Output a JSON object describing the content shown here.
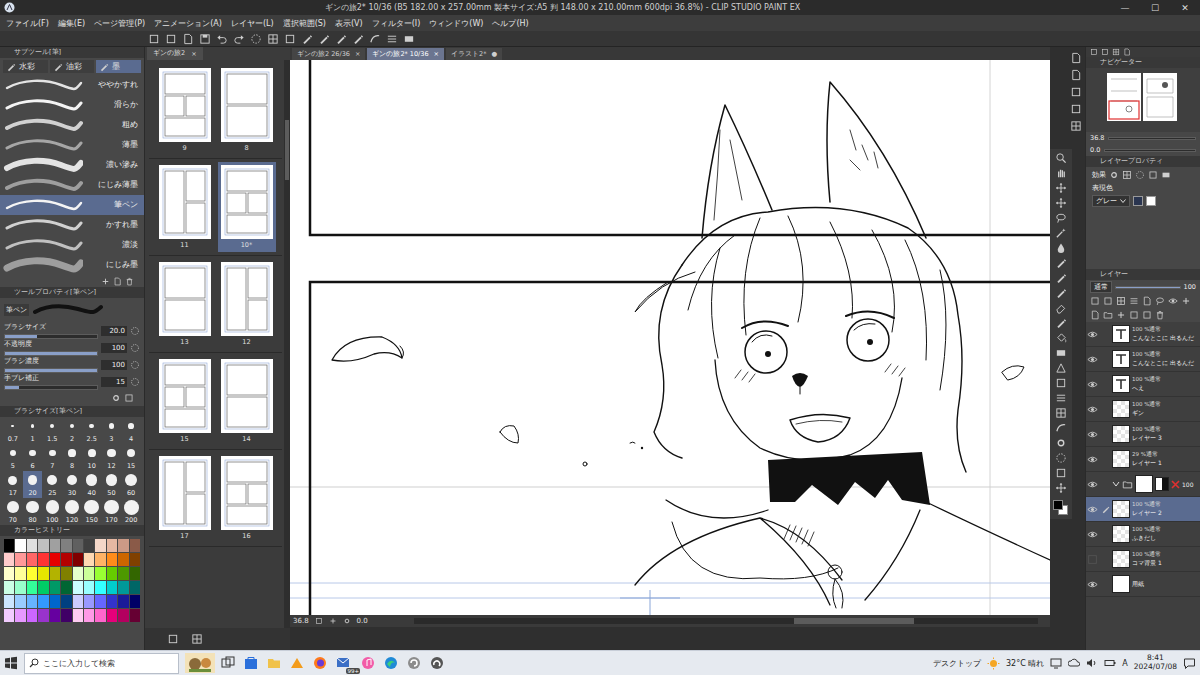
{
  "window": {
    "title": "ギンの旅2* 10/36 (B5 182.00 x 257.00mm 製本サイズ:A5 判 148.00 x 210.00mm 600dpi 36.8%) - CLIP STUDIO PAINT EX",
    "controls": [
      "—",
      "☐",
      "✕"
    ]
  },
  "menu": [
    "ファイル(F)",
    "編集(E)",
    "ページ管理(P)",
    "アニメーション(A)",
    "レイヤー(L)",
    "選択範囲(S)",
    "表示(V)",
    "フィルター(I)",
    "ウィンドウ(W)",
    "ヘルプ(H)"
  ],
  "doc_tab": {
    "label": "ギンの旅2",
    "close": "×"
  },
  "canvas_tabs": [
    {
      "label": "ギンの旅2 26/36",
      "close": "×",
      "selected": false
    },
    {
      "label": "ギンの旅2* 10/36",
      "close": "×",
      "selected": true
    },
    {
      "label": "イラスト2*",
      "close": "●",
      "selected": false
    }
  ],
  "subtool": {
    "title": "サブツール[筆]",
    "tabs": [
      {
        "label": "水彩",
        "selected": false
      },
      {
        "label": "油彩",
        "selected": false
      },
      {
        "label": "墨",
        "selected": true
      }
    ],
    "brushes": [
      {
        "name": "ややかすれ",
        "selected": false
      },
      {
        "name": "滑らか",
        "selected": false
      },
      {
        "name": "粗め",
        "selected": false
      },
      {
        "name": "薄墨",
        "selected": false
      },
      {
        "name": "濃い滲み",
        "selected": false
      },
      {
        "name": "にじみ薄墨",
        "selected": false
      },
      {
        "name": "筆ペン",
        "selected": true
      },
      {
        "name": "かすれ墨",
        "selected": false
      },
      {
        "name": "濃淡",
        "selected": false
      },
      {
        "name": "にじみ墨",
        "selected": false
      }
    ]
  },
  "tool_property": {
    "title": "ツールプロパティ[筆ペン]",
    "brush": "筆ペン",
    "params": [
      {
        "label": "ブラシサイズ",
        "value": "20.0",
        "level": 0.35
      },
      {
        "label": "不透明度",
        "value": "100",
        "level": 1
      },
      {
        "label": "ブラシ濃度",
        "value": "100",
        "level": 1
      },
      {
        "label": "手ブレ補正",
        "value": "15",
        "level": 0.15
      }
    ]
  },
  "brush_size": {
    "title": "ブラシサイズ[筆ペン]",
    "sizes": [
      {
        "label": "0.7",
        "selected": false
      },
      {
        "label": "1",
        "selected": false
      },
      {
        "label": "1.5",
        "selected": false
      },
      {
        "label": "2",
        "selected": false
      },
      {
        "label": "2.5",
        "selected": false
      },
      {
        "label": "3",
        "selected": false
      },
      {
        "label": "4",
        "selected": false
      },
      {
        "label": "5",
        "selected": false
      },
      {
        "label": "6",
        "selected": false
      },
      {
        "label": "7",
        "selected": false
      },
      {
        "label": "8",
        "selected": false
      },
      {
        "label": "10",
        "selected": false
      },
      {
        "label": "12",
        "selected": false
      },
      {
        "label": "15",
        "selected": false
      },
      {
        "label": "17",
        "selected": false
      },
      {
        "label": "20",
        "selected": true
      },
      {
        "label": "25",
        "selected": false
      },
      {
        "label": "30",
        "selected": false
      },
      {
        "label": "40",
        "selected": false
      },
      {
        "label": "50",
        "selected": false
      },
      {
        "label": "60",
        "selected": false
      },
      {
        "label": "70",
        "selected": false
      },
      {
        "label": "80",
        "selected": false
      },
      {
        "label": "100",
        "selected": false
      },
      {
        "label": "120",
        "selected": false
      },
      {
        "label": "150",
        "selected": false
      },
      {
        "label": "170",
        "selected": false
      },
      {
        "label": "200",
        "selected": false
      }
    ]
  },
  "color_history": {
    "title": "カラーヒストリー",
    "swatches": [
      {
        "color": "#000000"
      },
      {
        "color": "#ffffff"
      },
      {
        "color": "#e0e0e0"
      },
      {
        "color": "#c0c0c0"
      },
      {
        "color": "#a0a0a0"
      },
      {
        "color": "#808080"
      },
      {
        "color": "#606060"
      },
      {
        "color": "#404040"
      },
      {
        "color": "#f4d7c8"
      },
      {
        "color": "#e6b8a2"
      },
      {
        "color": "#cc9a86"
      },
      {
        "color": "#8a5a48"
      },
      {
        "color": "#ffcccc"
      },
      {
        "color": "#ff9999"
      },
      {
        "color": "#ff6666"
      },
      {
        "color": "#ff3333"
      },
      {
        "color": "#e60000"
      },
      {
        "color": "#b30000"
      },
      {
        "color": "#800000"
      },
      {
        "color": "#ffd9b3"
      },
      {
        "color": "#ffb366"
      },
      {
        "color": "#ff8c1a"
      },
      {
        "color": "#cc6600"
      },
      {
        "color": "#804000"
      },
      {
        "color": "#ffffcc"
      },
      {
        "color": "#ffff99"
      },
      {
        "color": "#ffff33"
      },
      {
        "color": "#e6e600"
      },
      {
        "color": "#b3b300"
      },
      {
        "color": "#808000"
      },
      {
        "color": "#e6ffcc"
      },
      {
        "color": "#ccff99"
      },
      {
        "color": "#99ff33"
      },
      {
        "color": "#66cc00"
      },
      {
        "color": "#4d9900"
      },
      {
        "color": "#336600"
      },
      {
        "color": "#ccffe6"
      },
      {
        "color": "#99ffcc"
      },
      {
        "color": "#33ff99"
      },
      {
        "color": "#00cc66"
      },
      {
        "color": "#009966"
      },
      {
        "color": "#006633"
      },
      {
        "color": "#ccffff"
      },
      {
        "color": "#99ffff"
      },
      {
        "color": "#33ffff"
      },
      {
        "color": "#00cccc"
      },
      {
        "color": "#009999"
      },
      {
        "color": "#006666"
      },
      {
        "color": "#cce6ff"
      },
      {
        "color": "#99ccff"
      },
      {
        "color": "#66b3ff"
      },
      {
        "color": "#3399ff"
      },
      {
        "color": "#0066cc"
      },
      {
        "color": "#004080"
      },
      {
        "color": "#ccccff"
      },
      {
        "color": "#9999ff"
      },
      {
        "color": "#6666ff"
      },
      {
        "color": "#3333cc"
      },
      {
        "color": "#1a1a99"
      },
      {
        "color": "#000066"
      },
      {
        "color": "#f2ccff"
      },
      {
        "color": "#e699ff"
      },
      {
        "color": "#cc66ff"
      },
      {
        "color": "#9933cc"
      },
      {
        "color": "#6600a0"
      },
      {
        "color": "#400066"
      },
      {
        "color": "#ffccf2"
      },
      {
        "color": "#ff99e6"
      },
      {
        "color": "#ff66cc"
      },
      {
        "color": "#e6007a"
      },
      {
        "color": "#b3005f"
      },
      {
        "color": "#660033"
      }
    ]
  },
  "pages": [
    {
      "left": {
        "label": "9",
        "selected": false
      },
      "right": {
        "label": "8",
        "selected": false
      }
    },
    {
      "left": {
        "label": "11",
        "selected": false
      },
      "right": {
        "label": "10*",
        "selected": true
      }
    },
    {
      "left": {
        "label": "13",
        "selected": false
      },
      "right": {
        "label": "12",
        "selected": false
      }
    },
    {
      "left": {
        "label": "15",
        "selected": false
      },
      "right": {
        "label": "14",
        "selected": false
      }
    },
    {
      "left": {
        "label": "17",
        "selected": false
      },
      "right": {
        "label": "16",
        "selected": false
      }
    }
  ],
  "canvas_status": {
    "zoom": "36.8",
    "angle": "0.0"
  },
  "tool_palette": {
    "main_color": "#000000",
    "sub_color": "#ffffff"
  },
  "navigator": {
    "title": "ナビゲーター",
    "zoom": "36.8",
    "angle": "0.0"
  },
  "layer_property": {
    "title": "レイヤープロパティ",
    "effect_label": "効果",
    "color_label": "表現色",
    "color_value": "グレー"
  },
  "layer_panel": {
    "title": "レイヤー",
    "blend": "通常",
    "opacity": "100",
    "opacity_level": 1,
    "layers": [
      {
        "kind": "text",
        "opacity": "100 %",
        "blend": "通常",
        "name": "こんなとこに 出るんだ",
        "visible": true,
        "selected": false
      },
      {
        "kind": "text",
        "opacity": "100 %",
        "blend": "通常",
        "name": "こんなとこに 出るんだ",
        "visible": true,
        "selected": false
      },
      {
        "kind": "text",
        "opacity": "100 %",
        "blend": "通常",
        "name": "へえ",
        "visible": true,
        "selected": false
      },
      {
        "kind": "raster",
        "opacity": "100 %",
        "blend": "通常",
        "name": "ギン",
        "visible": true,
        "selected": false
      },
      {
        "kind": "raster",
        "opacity": "100 %",
        "blend": "通常",
        "name": "レイヤー 3",
        "visible": true,
        "selected": false
      },
      {
        "kind": "raster",
        "opacity": "29 %",
        "blend": "通常",
        "name": "レイヤー 1",
        "visible": true,
        "selected": false
      },
      {
        "kind": "folder",
        "opacity": "100",
        "visible": true,
        "selected": false,
        "expanded": true
      },
      {
        "kind": "raster",
        "opacity": "100 %",
        "blend": "通常",
        "name": "レイヤー 2",
        "visible": true,
        "selected": true
      },
      {
        "kind": "raster",
        "opacity": "100 %",
        "blend": "通常",
        "name": "ふきだし",
        "visible": true,
        "selected": false
      },
      {
        "kind": "raster",
        "opacity": "100 %",
        "blend": "通常",
        "name": "コマ背景 1",
        "visible": false,
        "selected": false
      },
      {
        "kind": "paper",
        "name": "用紙",
        "visible": true,
        "selected": false
      }
    ]
  },
  "taskbar": {
    "search": "ここに入力して検索",
    "badge": "99+",
    "desktop": "デスクトップ",
    "weather": "32°C 晴れ",
    "ime": "A",
    "time": "8:41",
    "date": "2024/07/08"
  }
}
